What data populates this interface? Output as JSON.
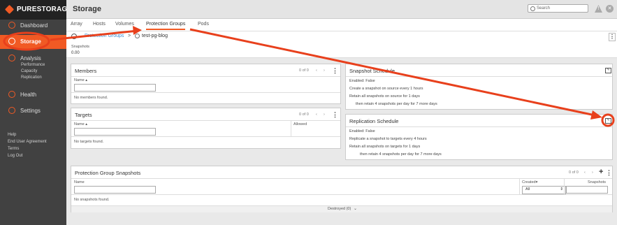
{
  "brand": {
    "name": "PURESTORAGE",
    "accent": "#f15a24"
  },
  "sidebar": {
    "items": [
      {
        "label": "Dashboard",
        "icon": "dashboard-icon"
      },
      {
        "label": "Storage",
        "icon": "storage-icon"
      },
      {
        "label": "Analysis",
        "icon": "analysis-icon"
      },
      {
        "label": "Health",
        "icon": "health-icon"
      },
      {
        "label": "Settings",
        "icon": "settings-icon"
      }
    ],
    "analysis_sub": [
      "Performance",
      "Capacity",
      "Replication"
    ],
    "footer": [
      "Help",
      "End User Agreement",
      "Terms",
      "Log Out"
    ]
  },
  "header": {
    "title": "Storage",
    "search_placeholder": "Search"
  },
  "tabs": [
    "Array",
    "Hosts",
    "Volumes",
    "Protection Groups",
    "Pods"
  ],
  "breadcrumb": {
    "parent": "Protection Groups",
    "separator": ">",
    "current": "test-pg-blog"
  },
  "snapshots": {
    "label": "Snapshots",
    "value": "0.00"
  },
  "members": {
    "title": "Members",
    "count": "0 of 0",
    "col_name": "Name",
    "empty": "No members found."
  },
  "targets": {
    "title": "Targets",
    "count": "0 of 0",
    "col_name": "Name",
    "col_allowed": "Allowed",
    "empty": "No targets found."
  },
  "snapshot_schedule": {
    "title": "Snapshot Schedule",
    "enabled_label": "Enabled:",
    "enabled_value": "False",
    "line1": "Create a snapshot on source every 1 hours",
    "line2": "Retain all snapshots on source for 1 days",
    "line3": "then retain 4 snapshots per day for 7 more days"
  },
  "replication_schedule": {
    "title": "Replication Schedule",
    "enabled_label": "Enabled:",
    "enabled_value": "False",
    "line1": "Replicate a snapshot to targets every 4 hours",
    "line2": "Retain all snapshots on targets for 1 days",
    "line3": "then retain 4 snapshots per day for 7 more days"
  },
  "pg_snapshots": {
    "title": "Protection Group Snapshots",
    "count": "0 of 0",
    "col_name": "Name",
    "col_created": "Created",
    "created_filter": "All",
    "col_snapshots": "Snapshots",
    "empty": "No snapshots found.",
    "destroyed": "Destroyed (0)"
  }
}
